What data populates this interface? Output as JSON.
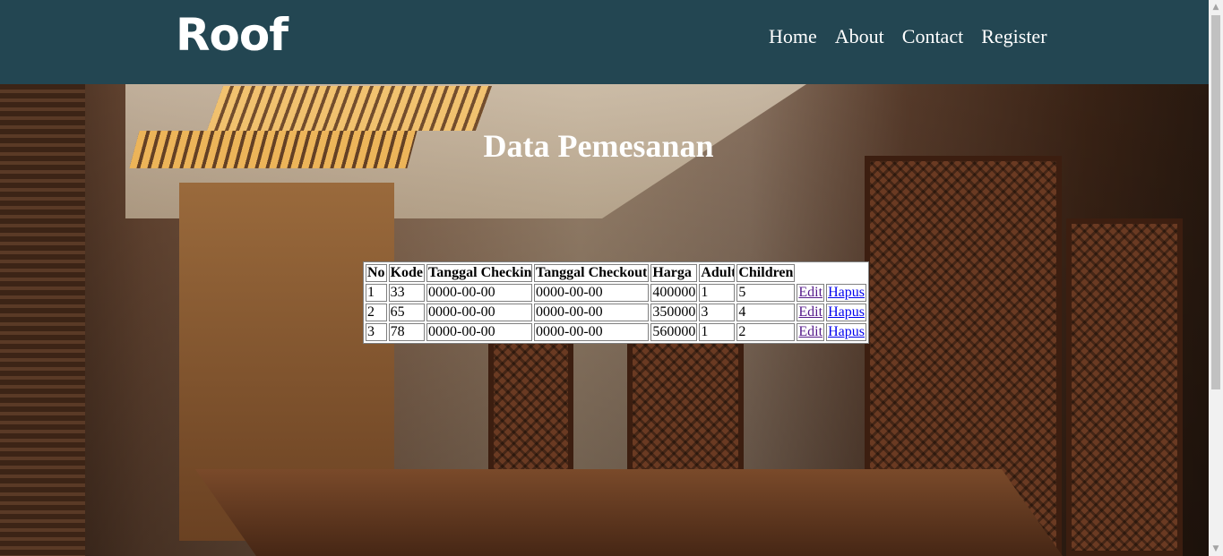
{
  "brand": {
    "logo": "Roof"
  },
  "nav": {
    "items": [
      {
        "label": "Home"
      },
      {
        "label": "About"
      },
      {
        "label": "Contact"
      },
      {
        "label": "Register"
      }
    ]
  },
  "page": {
    "title": "Data Pemesanan"
  },
  "table": {
    "headers": [
      "No",
      "Kode",
      "Tanggal Checkin",
      "Tanggal Checkout",
      "Harga",
      "Adult",
      "Children"
    ],
    "rows": [
      {
        "no": "1",
        "kode": "33",
        "checkin": "0000-00-00",
        "checkout": "0000-00-00",
        "harga": "400000",
        "adult": "1",
        "children": "5",
        "edit": "Edit",
        "hapus": "Hapus"
      },
      {
        "no": "2",
        "kode": "65",
        "checkin": "0000-00-00",
        "checkout": "0000-00-00",
        "harga": "350000",
        "adult": "3",
        "children": "4",
        "edit": "Edit",
        "hapus": "Hapus"
      },
      {
        "no": "3",
        "kode": "78",
        "checkin": "0000-00-00",
        "checkout": "0000-00-00",
        "harga": "560000",
        "adult": "1",
        "children": "2",
        "edit": "Edit",
        "hapus": "Hapus"
      }
    ]
  },
  "colors": {
    "navbar": "#234652",
    "link_visited": "#551a8b",
    "link": "#0000ee"
  },
  "icons": {
    "scroll_up": "triangle-up",
    "scroll_down": "triangle-down"
  }
}
